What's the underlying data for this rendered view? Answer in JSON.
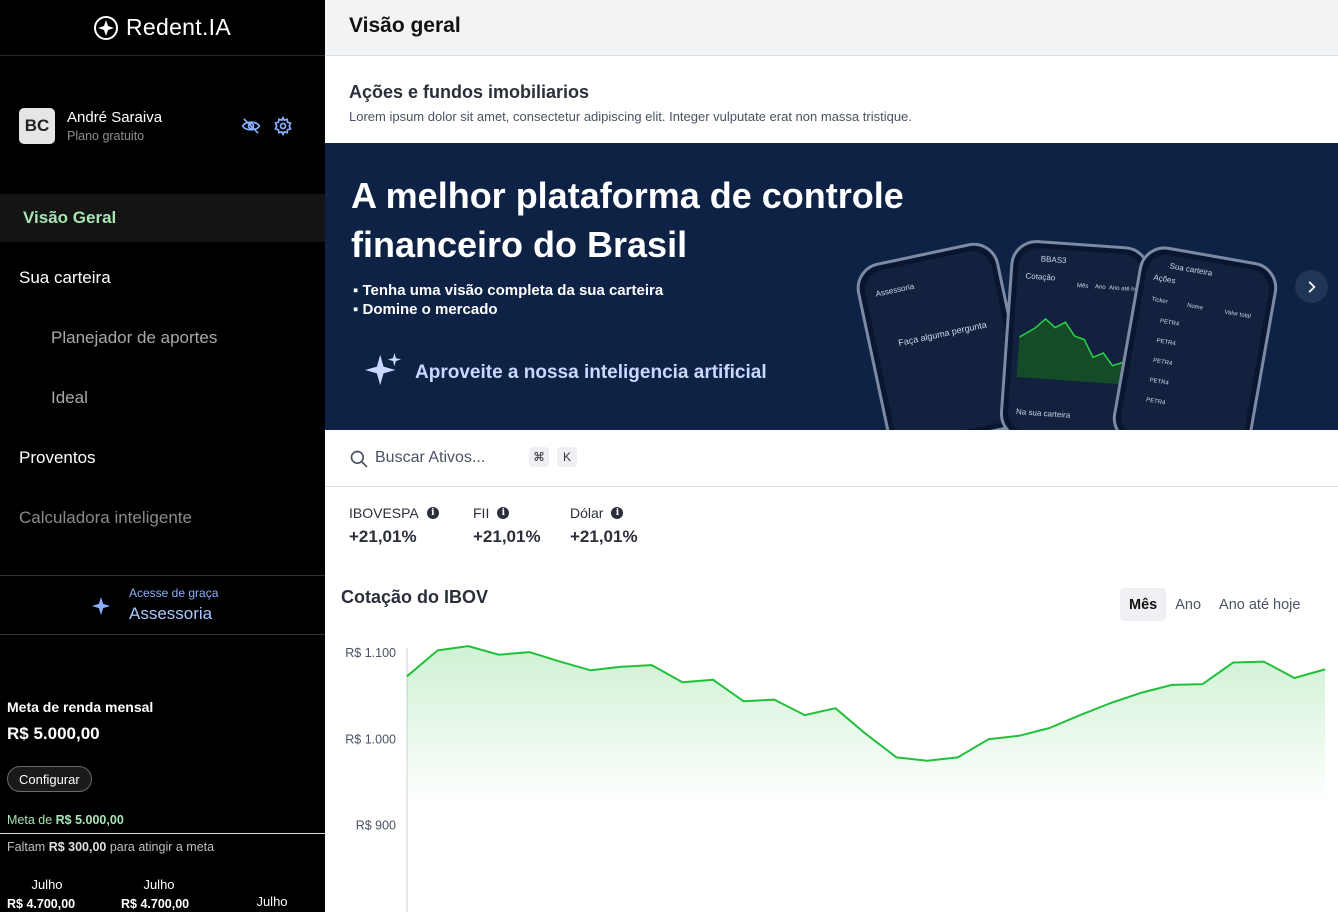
{
  "app": {
    "logo": "Redent.IA"
  },
  "user": {
    "initials": "BC",
    "name": "André Saraiva",
    "plan": "Plano gratuito"
  },
  "nav": {
    "overview": "Visão Geral",
    "portfolio": "Sua carteira",
    "planner": "Planejador de aportes",
    "ideal": "Ideal",
    "earnings": "Proventos",
    "calculator": "Calculadora inteligente"
  },
  "assessoria": {
    "small": "Acesse de graça",
    "big": "Assessoria"
  },
  "goal": {
    "label": "Meta de renda mensal",
    "value": "R$ 5.000,00",
    "configure": "Configurar",
    "meta_prefix": "Meta de",
    "meta_value": "R$ 5.000,00",
    "missing_prefix": "Faltam",
    "missing_value": "R$ 300,00",
    "missing_suffix": "para atingir a meta",
    "months": [
      {
        "month": "Julho",
        "value": "R$ 4.700,00"
      },
      {
        "month": "Julho",
        "value": "R$ 4.700,00"
      },
      {
        "month": "Julho"
      }
    ]
  },
  "header": {
    "title": "Visão geral"
  },
  "section": {
    "title": "Ações e fundos imobiliarios",
    "subtitle": "Lorem ipsum dolor sit amet, consectetur adipiscing elit. Integer vulputate erat non massa tristique."
  },
  "banner": {
    "title_line1": "A melhor plataforma de controle",
    "title_line2": "financeiro do Brasil",
    "bullet1": "Tenha uma visão completa da sua carteira",
    "bullet2": "Domine o mercado",
    "ai": "Aproveite a nossa inteligencia artificial",
    "phone1": {
      "header": "Assessoria",
      "question": "Faça alguma pergunta"
    },
    "phone2": {
      "ticker": "BBAS3",
      "header": "Cotação",
      "tab1": "Mês",
      "tab2": "Ano",
      "tab3": "Ano até hoje",
      "footer": "Na sua carteira"
    },
    "phone3": {
      "header": "Sua carteira",
      "sub": "Ações",
      "col1": "Ticker",
      "col2": "Nome",
      "col3": "Valor total",
      "ticker": "PETR4"
    }
  },
  "search": {
    "placeholder": "Buscar Ativos...",
    "key1": "⌘",
    "key2": "K"
  },
  "indices": [
    {
      "name": "IBOVESPA",
      "value": "+21,01%"
    },
    {
      "name": "FII",
      "value": "+21,01%"
    },
    {
      "name": "Dólar",
      "value": "+21,01%"
    }
  ],
  "chart_title": "Cotação do IBOV",
  "range_tabs": [
    "Mês",
    "Ano",
    "Ano até hoje"
  ],
  "colors": {
    "accent_green": "#22c03a",
    "banner_bg": "#0d2244",
    "nav_active": "#a7e6b3"
  },
  "chart_data": {
    "type": "area",
    "title": "Cotação do IBOV",
    "yticks": [
      "R$ 1.100",
      "R$ 1.000",
      "R$ 900"
    ],
    "ylim": [
      780,
      1100
    ],
    "grid": false,
    "series": [
      {
        "values": [
          1073,
          1103,
          1108,
          1098,
          1101,
          1090,
          1080,
          1084,
          1086,
          1066,
          1069,
          1044,
          1046,
          1028,
          1036,
          1006,
          979,
          975,
          979,
          1000,
          1004,
          1013,
          1028,
          1042,
          1054,
          1063,
          1064,
          1089,
          1090,
          1071,
          1081
        ]
      }
    ]
  }
}
